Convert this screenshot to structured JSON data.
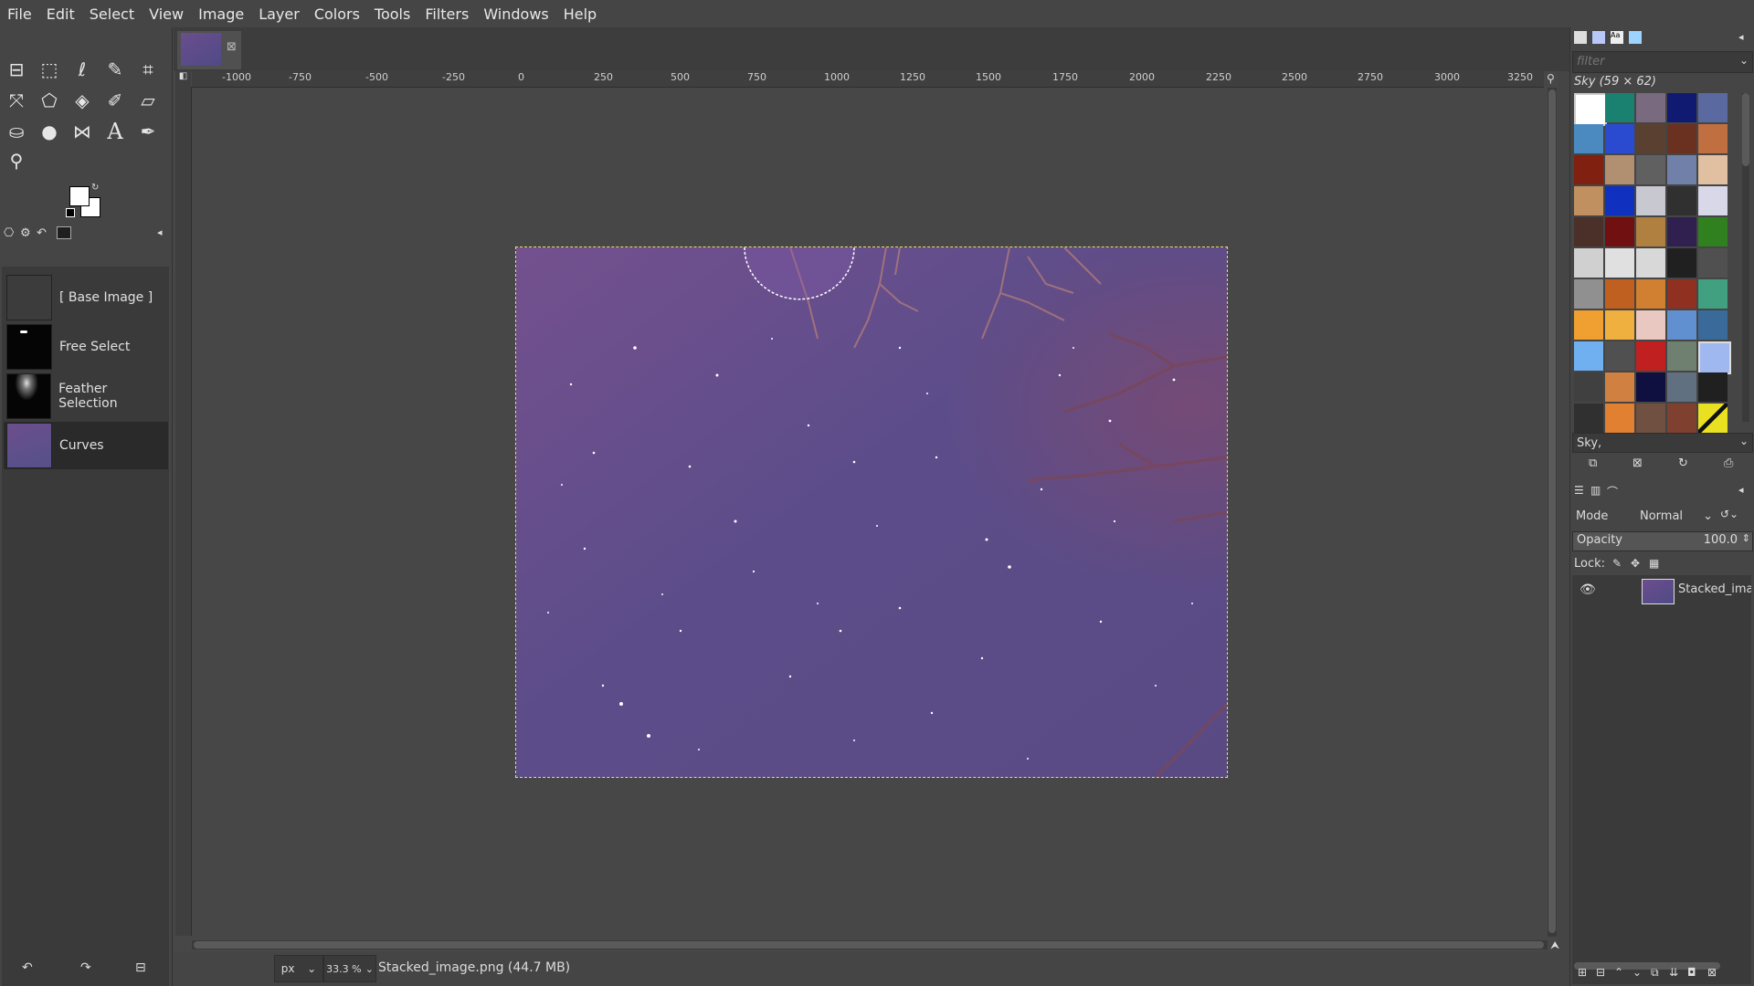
{
  "menu": [
    "File",
    "Edit",
    "Select",
    "View",
    "Image",
    "Layer",
    "Colors",
    "Tools",
    "Filters",
    "Windows",
    "Help"
  ],
  "ruler": {
    "h_labels": [
      "-1000",
      "-750",
      "-500",
      "-250",
      "0",
      "250",
      "500",
      "750",
      "1000",
      "1250",
      "1500",
      "1750",
      "2000",
      "2250",
      "2500",
      "2750",
      "3000",
      "3250"
    ]
  },
  "history": {
    "items": [
      {
        "label": "[ Base Image ]"
      },
      {
        "label": "Free Select"
      },
      {
        "label": "Feather Selection"
      },
      {
        "label": "Curves"
      }
    ]
  },
  "status": {
    "unit": "px",
    "zoom": "33.3 %",
    "file_info": "Stacked_image.png (44.7 MB)"
  },
  "patterns": {
    "filter_placeholder": "filter",
    "title": "Sky (59 × 62)",
    "selected_name": "Sky,"
  },
  "layers": {
    "mode_label": "Mode",
    "mode_value": "Normal",
    "opacity_label": "Opacity",
    "opacity_value": "100.0",
    "lock_label": "Lock:",
    "items": [
      {
        "name": "Stacked_imag"
      }
    ]
  },
  "colors": {
    "canvas_bg": "#474747",
    "image_top": "#6e4e8c",
    "image_bottom": "#5a4d86",
    "selection": "#e8e070"
  }
}
